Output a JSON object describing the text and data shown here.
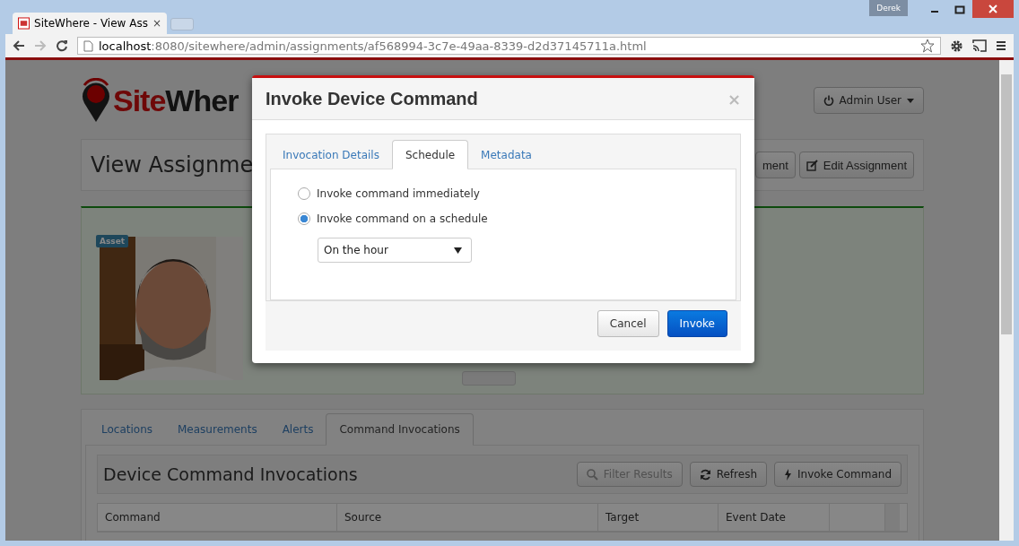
{
  "browser": {
    "tab_title": "SiteWhere - View Ass",
    "close": "×",
    "user_badge": "Derek",
    "url_host": "localhost",
    "url_path": ":8080/sitewhere/admin/assignments/af568994-3c7e-49aa-8339-d2d37145711a.html"
  },
  "header": {
    "logo_red": "Site",
    "logo_dark": "Wher",
    "user_menu": "Admin User"
  },
  "page_title": "View Assignme",
  "header_buttons": [
    "ment",
    "Edit Assignment"
  ],
  "asset_badge": "Asset",
  "tabs": [
    {
      "label": "Locations",
      "selected": false
    },
    {
      "label": "Measurements",
      "selected": false
    },
    {
      "label": "Alerts",
      "selected": false
    },
    {
      "label": "Command Invocations",
      "selected": true
    }
  ],
  "section_title": "Device Command Invocations",
  "section_buttons": [
    {
      "label": "Filter Results",
      "disabled": true
    },
    {
      "label": "Refresh",
      "disabled": false
    },
    {
      "label": "Invoke Command",
      "disabled": false
    }
  ],
  "table": {
    "columns": [
      "Command",
      "Source",
      "Target",
      "Event Date"
    ]
  },
  "modal": {
    "title": "Invoke Device Command",
    "close": "×",
    "tabs": [
      {
        "label": "Invocation Details",
        "selected": false
      },
      {
        "label": "Schedule",
        "selected": true
      },
      {
        "label": "Metadata",
        "selected": false
      }
    ],
    "options": [
      {
        "label": "Invoke command immediately",
        "selected": false
      },
      {
        "label": "Invoke command on a schedule",
        "selected": true
      }
    ],
    "schedule": {
      "value": "On the hour"
    },
    "buttons": [
      {
        "label": "Cancel",
        "kind": "default"
      },
      {
        "label": "Invoke",
        "kind": "primary"
      }
    ]
  }
}
